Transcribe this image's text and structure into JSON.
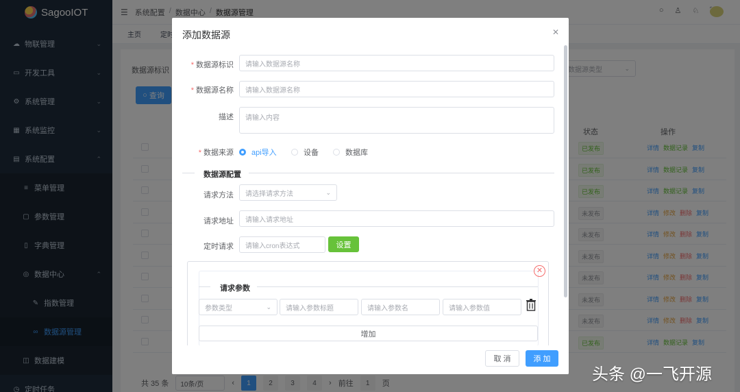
{
  "app": {
    "name": "SagooIOT"
  },
  "sidebar": {
    "items": [
      {
        "label": "物联管理",
        "icon": "cloud-icon"
      },
      {
        "label": "开发工具",
        "icon": "monitor-icon"
      },
      {
        "label": "系统管理",
        "icon": "gear-icon"
      },
      {
        "label": "系统监控",
        "icon": "chart-icon"
      },
      {
        "label": "系统配置",
        "icon": "config-icon"
      },
      {
        "label": "菜单管理",
        "icon": "list-icon"
      },
      {
        "label": "参数管理",
        "icon": "doc-icon"
      },
      {
        "label": "字典管理",
        "icon": "book-icon"
      },
      {
        "label": "数据中心",
        "icon": "database-icon"
      },
      {
        "label": "指数管理",
        "icon": "brush-icon"
      },
      {
        "label": "数据源管理",
        "icon": "link-icon"
      },
      {
        "label": "数据建模",
        "icon": "model-icon"
      },
      {
        "label": "定时任务",
        "icon": "clock-icon"
      }
    ]
  },
  "header": {
    "breadcrumb": [
      "系统配置",
      "数据中心",
      "数据源管理"
    ],
    "breadcrumb_sep": "/"
  },
  "tabs": [
    "主页",
    "定时"
  ],
  "main": {
    "filter_label": "数据源标识",
    "query_button": "查询",
    "type_placeholder": "数据源类型",
    "columns": {
      "status": "状态",
      "ops": "操作"
    },
    "rows": [
      {
        "status": "已发布",
        "state": "pub"
      },
      {
        "status": "已发布",
        "state": "pub"
      },
      {
        "status": "已发布",
        "state": "pub"
      },
      {
        "status": "未发布",
        "state": "unpub"
      },
      {
        "status": "未发布",
        "state": "unpub"
      },
      {
        "status": "未发布",
        "state": "unpub"
      },
      {
        "status": "未发布",
        "state": "unpub"
      },
      {
        "status": "未发布",
        "state": "unpub"
      },
      {
        "status": "未发布",
        "state": "unpub"
      },
      {
        "status": "已发布",
        "state": "pub"
      }
    ],
    "actions_pub": [
      "详情",
      "数据记录",
      "复制"
    ],
    "actions_unpub": [
      "详情",
      "修改",
      "删除",
      "复制"
    ],
    "pager": {
      "total": "共 35 条",
      "size": "10条/页",
      "pages": [
        "1",
        "2",
        "3",
        "4"
      ],
      "goto": "前往",
      "page_input": "1",
      "unit": "页"
    }
  },
  "dialog": {
    "title": "添加数据源",
    "fields": {
      "key_label": "数据源标识",
      "key_placeholder": "请输入数据源名称",
      "name_label": "数据源名称",
      "name_placeholder": "请输入数据源名称",
      "desc_label": "描述",
      "desc_placeholder": "请输入内容",
      "source_label": "数据来源",
      "source_options": [
        "api导入",
        "设备",
        "数据库"
      ]
    },
    "config": {
      "section_title": "数据源配置",
      "method_label": "请求方法",
      "method_placeholder": "请选择请求方法",
      "url_label": "请求地址",
      "url_placeholder": "请输入请求地址",
      "cron_label": "定时请求",
      "cron_placeholder": "请输入cron表达式",
      "set_button": "设置"
    },
    "params": {
      "section_title": "请求参数",
      "type_placeholder": "参数类型",
      "title_placeholder": "请输入参数标题",
      "name_placeholder": "请输入参数名",
      "value_placeholder": "请输入参数值",
      "add_button": "增加"
    },
    "footer": {
      "cancel": "取 消",
      "submit": "添 加"
    }
  },
  "watermark": "头条 @一飞开源"
}
